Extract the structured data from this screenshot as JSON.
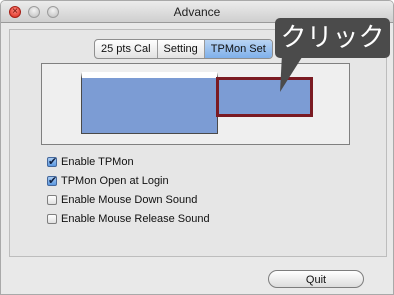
{
  "window": {
    "title": "Advance"
  },
  "tabs": [
    {
      "label": "25 pts Cal",
      "selected": false
    },
    {
      "label": "Setting",
      "selected": false
    },
    {
      "label": "TPMon Set",
      "selected": true
    }
  ],
  "checkboxes": [
    {
      "label": "Enable TPMon",
      "checked": true
    },
    {
      "label": "TPMon Open at Login",
      "checked": true
    },
    {
      "label": "Enable Mouse Down Sound",
      "checked": false
    },
    {
      "label": "Enable Mouse Release Sound",
      "checked": false
    }
  ],
  "buttons": {
    "quit": "Quit"
  },
  "callout": {
    "text": "クリック"
  },
  "colors": {
    "screen_fill": "#7c9cd4",
    "selected_border": "#7a1a22",
    "callout_bg": "#4b4b4b"
  },
  "icons": {
    "close": "close-icon",
    "minimize": "minimize-icon",
    "zoom": "zoom-icon",
    "check": "checkmark-icon"
  }
}
